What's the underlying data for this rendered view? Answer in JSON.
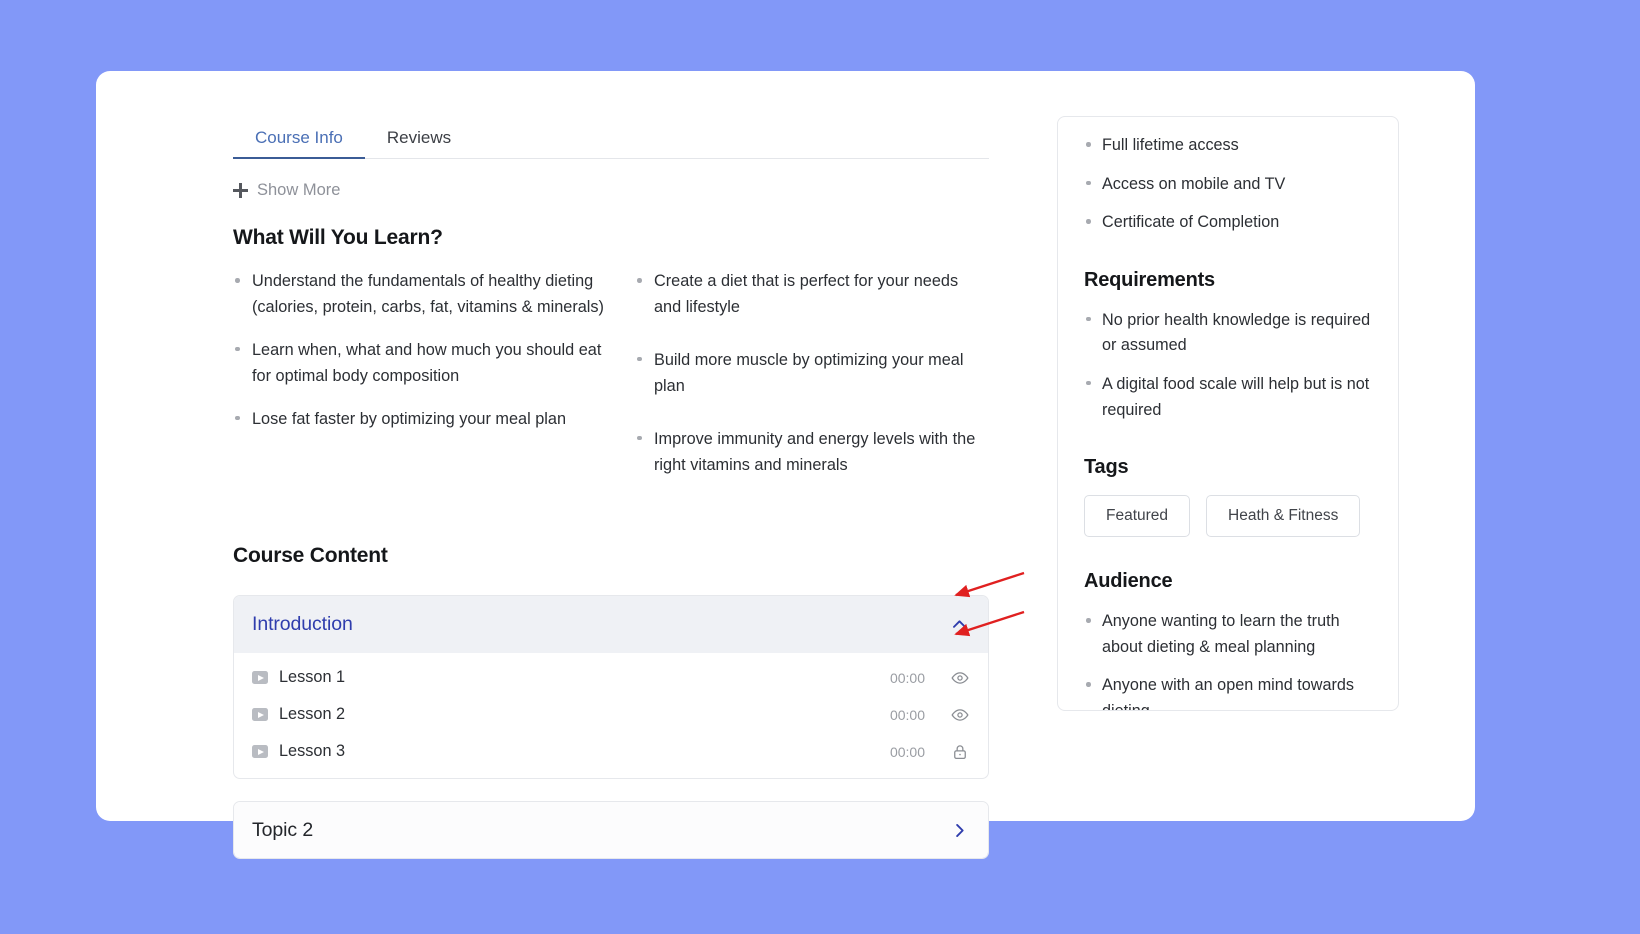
{
  "tabs": [
    {
      "label": "Course Info",
      "active": true
    },
    {
      "label": "Reviews",
      "active": false
    }
  ],
  "show_more": {
    "label": "Show More",
    "icon": "plus-icon"
  },
  "learn": {
    "title": "What Will You Learn?",
    "left_items": [
      "Understand the fundamentals of healthy dieting (calories, protein, carbs, fat, vitamins & minerals)",
      "Learn when, what and how much you should eat for optimal body composition",
      "Lose fat faster by optimizing your meal plan"
    ],
    "right_items": [
      "Create a diet that is perfect for your needs and lifestyle",
      "Build more muscle by optimizing your meal plan",
      "Improve immunity and energy levels with the right vitamins and minerals"
    ]
  },
  "course_content": {
    "title": "Course Content",
    "sections": [
      {
        "label": "Introduction",
        "expanded": true,
        "chevron": "chevron-up-icon",
        "lessons": [
          {
            "name": "Lesson 1",
            "duration": "00:00",
            "state": "eye-icon"
          },
          {
            "name": "Lesson 2",
            "duration": "00:00",
            "state": "eye-icon"
          },
          {
            "name": "Lesson 3",
            "duration": "00:00",
            "state": "lock-icon"
          }
        ]
      },
      {
        "label": "Topic 2",
        "expanded": false,
        "chevron": "chevron-right-icon",
        "lessons": []
      }
    ]
  },
  "sidebar": {
    "features": [
      "Full lifetime access",
      "Access on mobile and TV",
      "Certificate of Completion"
    ],
    "requirements_title": "Requirements",
    "requirements": [
      "No prior health knowledge is required or assumed",
      "A digital food scale will help but is not required"
    ],
    "tags_title": "Tags",
    "tags": [
      "Featured",
      "Heath & Fitness"
    ],
    "audience_title": "Audience",
    "audience": [
      "Anyone wanting to learn the truth about dieting & meal planning",
      "Anyone with an open mind towards dieting"
    ]
  },
  "colors": {
    "page_background": "#8298f8",
    "accent_blue": "#2f3dad",
    "tab_active": "#4a6fb5",
    "annotation_arrow": "#e02020",
    "accordion_header": "#eff1f5"
  }
}
